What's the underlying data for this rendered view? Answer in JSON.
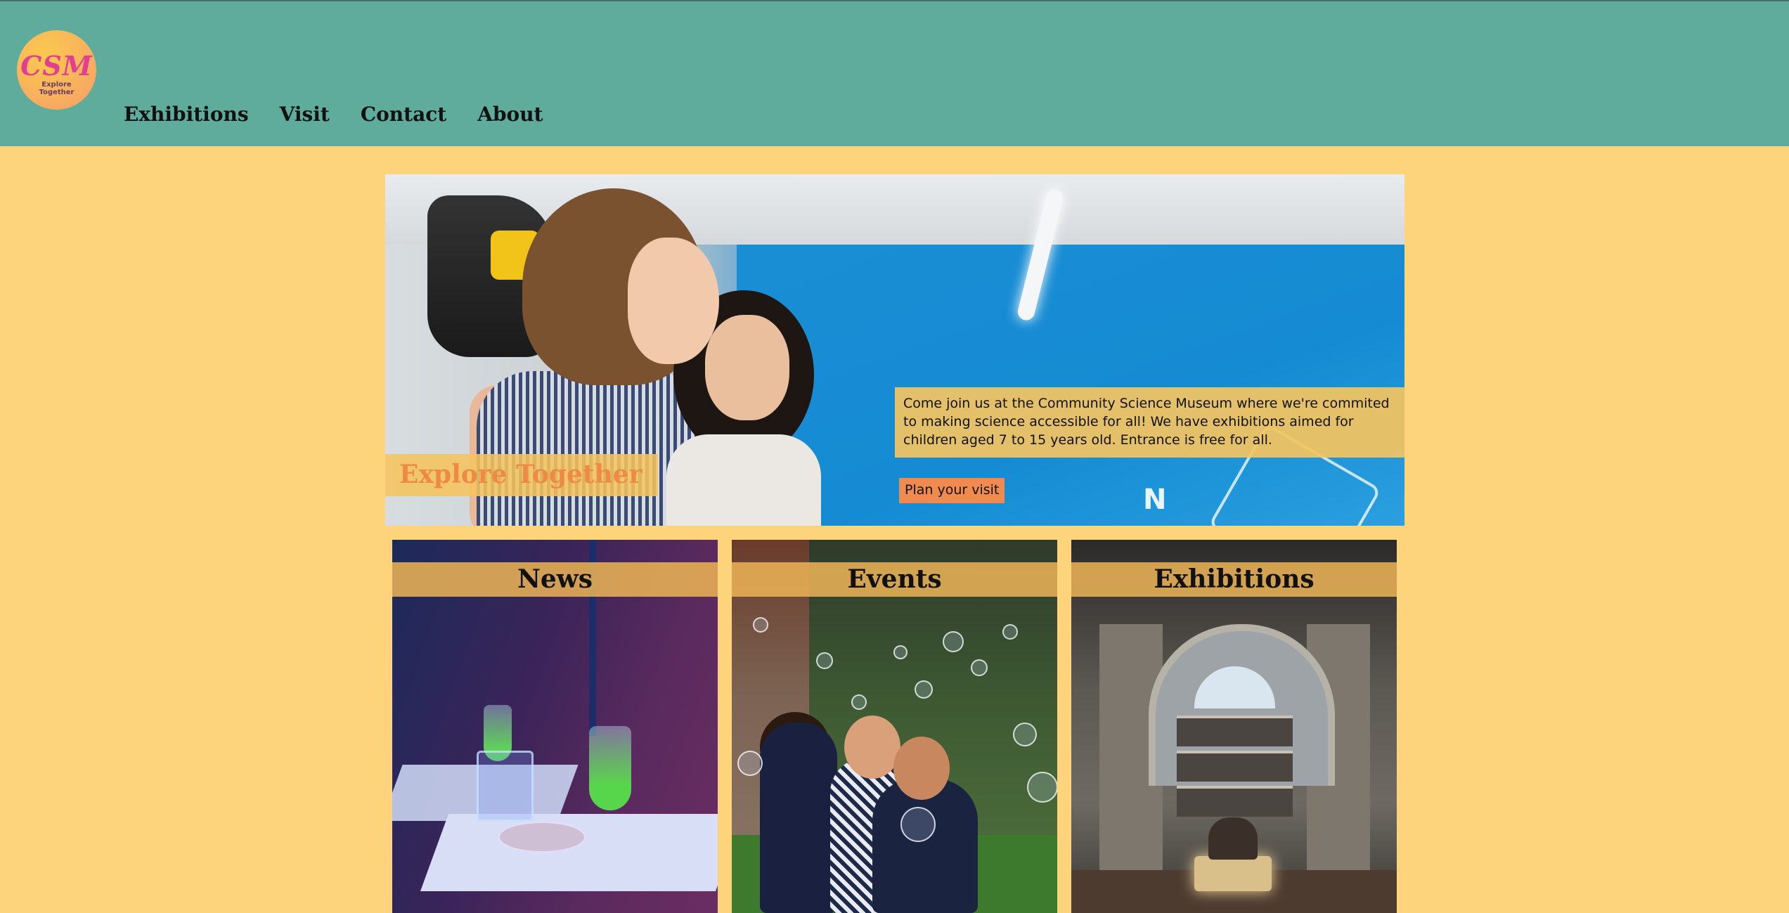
{
  "header": {
    "logo": {
      "mark": "CSM",
      "tagline": "Explore Together"
    },
    "nav": [
      {
        "label": "Exhibitions"
      },
      {
        "label": "Visit"
      },
      {
        "label": "Contact"
      },
      {
        "label": "About"
      }
    ]
  },
  "hero": {
    "tagline": "Explore Together",
    "description": "Come join us at the Community Science Museum where we're commited to making science accessible for all! We have exhibitions aimed for children aged 7 to 15 years old. Entrance is free for all.",
    "cta_label": "Plan your visit",
    "decor_text": "N"
  },
  "cards": [
    {
      "title": "News"
    },
    {
      "title": "Events"
    },
    {
      "title": "Exhibitions"
    }
  ],
  "colors": {
    "page_bg": "#fdd37c",
    "header_bg": "#5fab9c",
    "accent_orange": "#f08a4e",
    "tagline_text": "#ef8a45",
    "logo_magenta": "#e0408f"
  }
}
